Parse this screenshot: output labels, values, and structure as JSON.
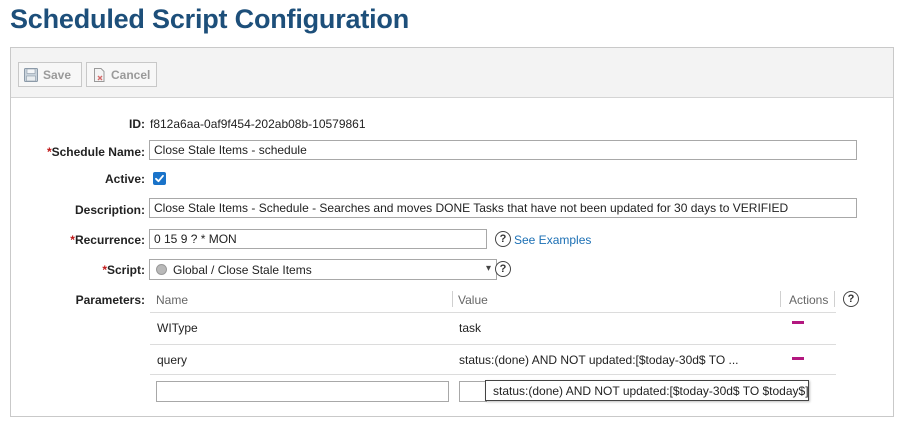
{
  "page": {
    "title": "Scheduled Script Configuration"
  },
  "toolbar": {
    "save_label": "Save",
    "cancel_label": "Cancel",
    "save_icon": "floppy-disk-icon",
    "cancel_icon": "document-x-icon"
  },
  "form": {
    "id_label": "ID:",
    "id_value": "f812a6aa-0af9f454-202ab08b-10579861",
    "schedule_name_required": "*",
    "schedule_name_label": "Schedule Name:",
    "schedule_name_value": "Close Stale Items - schedule",
    "active_label": "Active:",
    "active_checked": true,
    "description_label": "Description:",
    "description_value": "Close Stale Items - Schedule - Searches and moves DONE Tasks that have not been updated for 30 days to VERIFIED",
    "recurrence_required": "*",
    "recurrence_label": "Recurrence:",
    "recurrence_value": "0 15 9 ? * MON",
    "help_glyph": "?",
    "see_examples_label": "See Examples",
    "script_required": "*",
    "script_label": "Script:",
    "script_value": "Global / Close Stale Items",
    "script_icon": "globe-icon",
    "parameters_label": "Parameters:"
  },
  "parameters": {
    "columns": {
      "name": "Name",
      "value": "Value",
      "actions": "Actions"
    },
    "rows": [
      {
        "name": "WIType",
        "value": "task"
      },
      {
        "name": "query",
        "value": "status:(done) AND NOT updated:[$today-30d$ TO ..."
      }
    ],
    "new_row": {
      "name": "",
      "value": ""
    },
    "tooltip": "status:(done) AND NOT updated:[$today-30d$ TO $today$]"
  },
  "colors": {
    "title": "#1d4f7a",
    "required": "#c01818",
    "link": "#1b6fb4",
    "remove_action": "#b3177f",
    "checkbox": "#1a73c9"
  }
}
